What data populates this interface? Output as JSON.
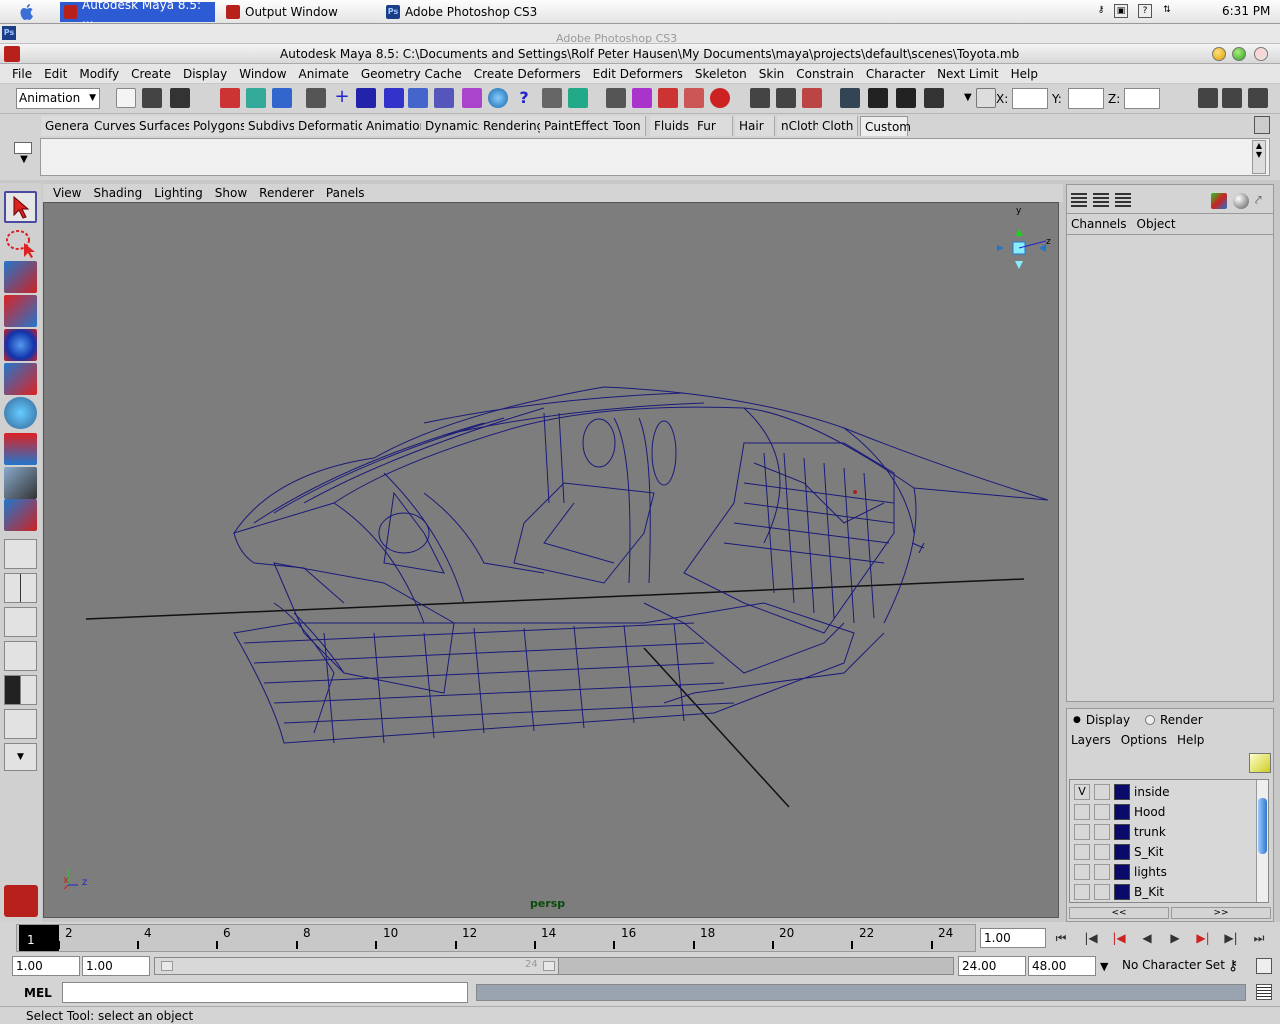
{
  "taskbar": {
    "items": [
      {
        "label": "Autodesk Maya 8.5: ...",
        "active": true
      },
      {
        "label": "Output Window",
        "active": false
      },
      {
        "label": "Adobe Photoshop CS3",
        "active": false
      }
    ],
    "clock": "6:31 PM",
    "ps_badge": "Ps"
  },
  "ghost_title": "Adobe Photoshop CS3",
  "window": {
    "title": "Autodesk Maya 8.5: C:\\Documents and Settings\\Rolf Peter Hausen\\My Documents\\maya\\projects\\default\\scenes\\Toyota.mb"
  },
  "menubar": [
    "File",
    "Edit",
    "Modify",
    "Create",
    "Display",
    "Window",
    "Animate",
    "Geometry Cache",
    "Create Deformers",
    "Edit Deformers",
    "Skeleton",
    "Skin",
    "Constrain",
    "Character",
    "Next Limit",
    "Help"
  ],
  "statusline": {
    "mode": "Animation",
    "x_label": "X:",
    "y_label": "Y:",
    "z_label": "Z:"
  },
  "shelf": {
    "tabs": [
      "General",
      "Curves",
      "Surfaces",
      "Polygons",
      "Subdivs",
      "Deformation",
      "Animation",
      "Dynamics",
      "Rendering",
      "PaintEffects",
      "Toon",
      "Fluids",
      "Fur",
      "Hair",
      "nCloth",
      "Cloth",
      "Custom"
    ],
    "active": "Custom"
  },
  "viewport": {
    "menu": [
      "View",
      "Shading",
      "Lighting",
      "Show",
      "Renderer",
      "Panels"
    ],
    "camera_label": "persp",
    "axis_x": "x",
    "axis_y": "y",
    "axis_z": "z",
    "wire_color": "#1a1a7a",
    "bg_color": "#7d7d7d"
  },
  "channelbox": {
    "menu": [
      "Channels",
      "Object"
    ]
  },
  "layers": {
    "mode_display": "Display",
    "mode_render": "Render",
    "menu": [
      "Layers",
      "Options",
      "Help"
    ],
    "rows": [
      {
        "name": "inside",
        "visible": "V"
      },
      {
        "name": "Hood",
        "visible": ""
      },
      {
        "name": "trunk",
        "visible": ""
      },
      {
        "name": "S_Kit",
        "visible": ""
      },
      {
        "name": "lights",
        "visible": ""
      },
      {
        "name": "B_Kit",
        "visible": ""
      }
    ],
    "scroll_left": "<<",
    "scroll_right": ">>"
  },
  "timeline": {
    "current_frame": "1",
    "ticks": [
      "2",
      "4",
      "6",
      "8",
      "10",
      "12",
      "14",
      "16",
      "18",
      "20",
      "22",
      "24"
    ],
    "current_time": "1.00"
  },
  "range": {
    "start": "1.00",
    "playback_start": "1.00",
    "slider_end_label": "24",
    "playback_end": "24.00",
    "end": "48.00",
    "character_set": "No Character Set"
  },
  "mel": {
    "label": "MEL"
  },
  "help_line": "Select Tool: select an object"
}
